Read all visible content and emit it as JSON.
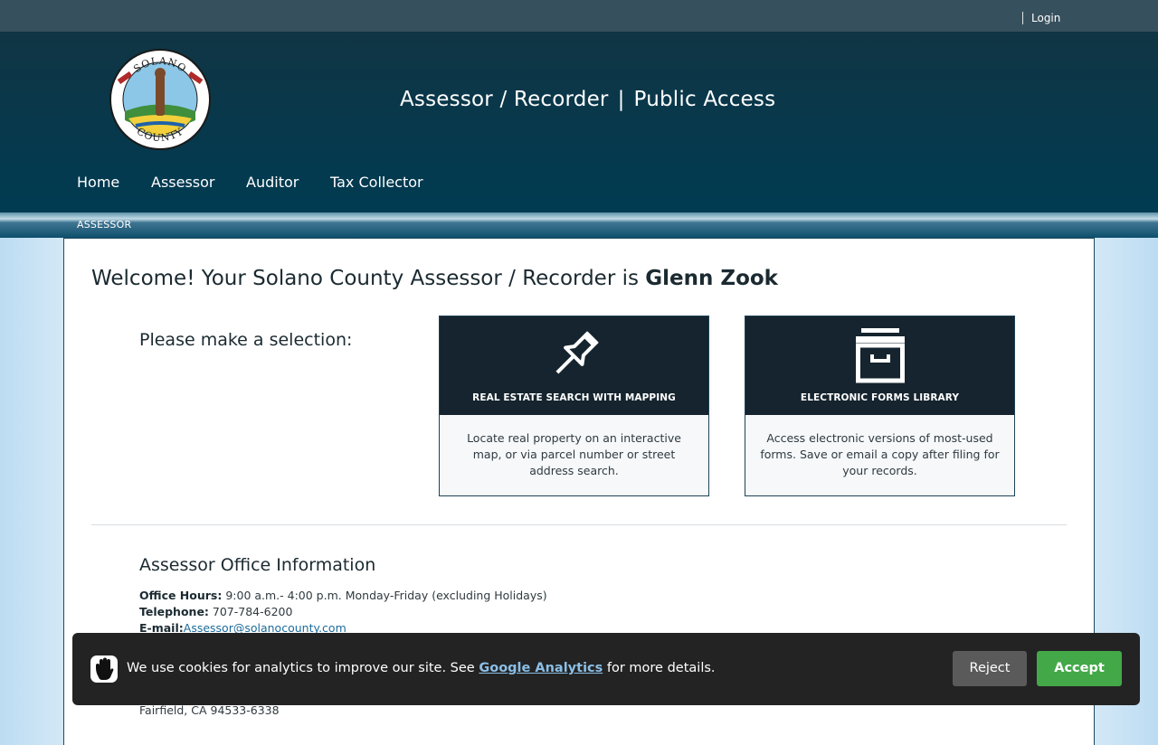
{
  "topbar": {
    "login_label": "Login"
  },
  "header": {
    "logo_text_top": "SOLANO",
    "logo_text_bottom": "COUNTY",
    "title_left": "Assessor / Recorder",
    "title_sep": "|",
    "title_right": "Public Access"
  },
  "nav": {
    "items": [
      "Home",
      "Assessor",
      "Auditor",
      "Tax Collector"
    ]
  },
  "breadcrumb": {
    "current": "ASSESSOR"
  },
  "main": {
    "welcome_prefix": "Welcome! Your Solano County Assessor / Recorder is ",
    "welcome_name": "Glenn Zook",
    "prompt": "Please make a selection:",
    "cards": [
      {
        "icon": "pushpin-icon",
        "title": "REAL ESTATE SEARCH WITH MAPPING",
        "description": "Locate real property on an interactive map, or via parcel number or street address search."
      },
      {
        "icon": "archive-box-icon",
        "title": "ELECTRONIC FORMS LIBRARY",
        "description": "Access electronic versions of most-used forms. Save or email a copy after filing for your records."
      }
    ]
  },
  "info": {
    "title": "Assessor Office Information",
    "hours_label": "Office Hours:",
    "hours_value": " 9:00 a.m.- 4:00 p.m. Monday-Friday (excluding Holidays)",
    "phone_label": "Telephone:",
    "phone_value": " 707-784-6200",
    "email_label": "E-mail:",
    "email_value": "Assessor@solanocounty.com",
    "address_city": "Fairfield, CA 94533-6338"
  },
  "cookie": {
    "message_prefix": "We use cookies for analytics to improve our site. See ",
    "link_label": "Google Analytics",
    "message_suffix": " for more details.",
    "reject_label": "Reject",
    "accept_label": "Accept"
  },
  "colors": {
    "topbar": "#37505d",
    "header": "#003b52",
    "card_dark": "#15242e",
    "accept_green": "#43a848",
    "reject_gray": "#5a5a5a"
  }
}
